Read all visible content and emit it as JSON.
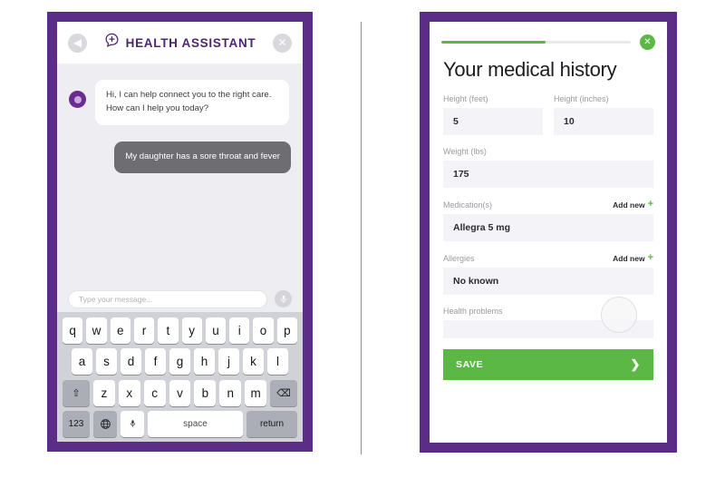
{
  "divider": {
    "name": "panel-divider"
  },
  "chat_phone": {
    "header": {
      "back_icon": "◀",
      "back_icon_name": "back-icon",
      "logo_icon_name": "chat-bubble-plus-icon",
      "title": "HEALTH ASSISTANT",
      "close_icon": "✕",
      "close_icon_name": "close-icon"
    },
    "messages": [
      {
        "from": "assistant",
        "text": "Hi, I can help connect you to the right care. How can I help you today?"
      },
      {
        "from": "user",
        "text": "My daughter has a sore throat and fever"
      }
    ],
    "input": {
      "placeholder": "Type your message...",
      "value": "",
      "mic_icon_name": "microphone-icon"
    },
    "keyboard": {
      "row1": [
        "q",
        "w",
        "e",
        "r",
        "t",
        "y",
        "u",
        "i",
        "o",
        "p"
      ],
      "row2": [
        "a",
        "s",
        "d",
        "f",
        "g",
        "h",
        "j",
        "k",
        "l"
      ],
      "row3_shift": "⇧",
      "row3": [
        "z",
        "x",
        "c",
        "v",
        "b",
        "n",
        "m"
      ],
      "row3_backspace": "⌫",
      "row4": {
        "numbers": "123",
        "globe": "⊕",
        "mic": "🎙",
        "space": "space",
        "return": "return"
      }
    }
  },
  "form_phone": {
    "progress": {
      "percent": 55,
      "close_icon": "✕",
      "close_icon_name": "close-icon"
    },
    "title": "Your medical history",
    "fields": [
      {
        "label": "Height (feet)",
        "value": "5",
        "name": "height-feet"
      },
      {
        "label": "Height (inches)",
        "value": "10",
        "name": "height-inches"
      },
      {
        "label": "Weight (lbs)",
        "value": "175",
        "name": "weight-lbs"
      },
      {
        "label": "Medication(s)",
        "value": "Allegra 5 mg",
        "name": "medications",
        "add_new": "Add new"
      },
      {
        "label": "Allergies",
        "value": "No known",
        "name": "allergies",
        "add_new": "Add new"
      },
      {
        "label": "Health problems",
        "value": "",
        "name": "health-problems"
      }
    ],
    "add_new_label": "Add new",
    "add_new_plus": "+",
    "save": {
      "label": "SAVE",
      "chevron": "❯"
    }
  },
  "colors": {
    "purple_frame": "#5b2d87",
    "purple_title": "#4b2673",
    "green": "#5cb845",
    "chat_bg": "#eeeef2",
    "user_bubble": "#6d6d72",
    "field_bg": "#f4f3f7"
  }
}
